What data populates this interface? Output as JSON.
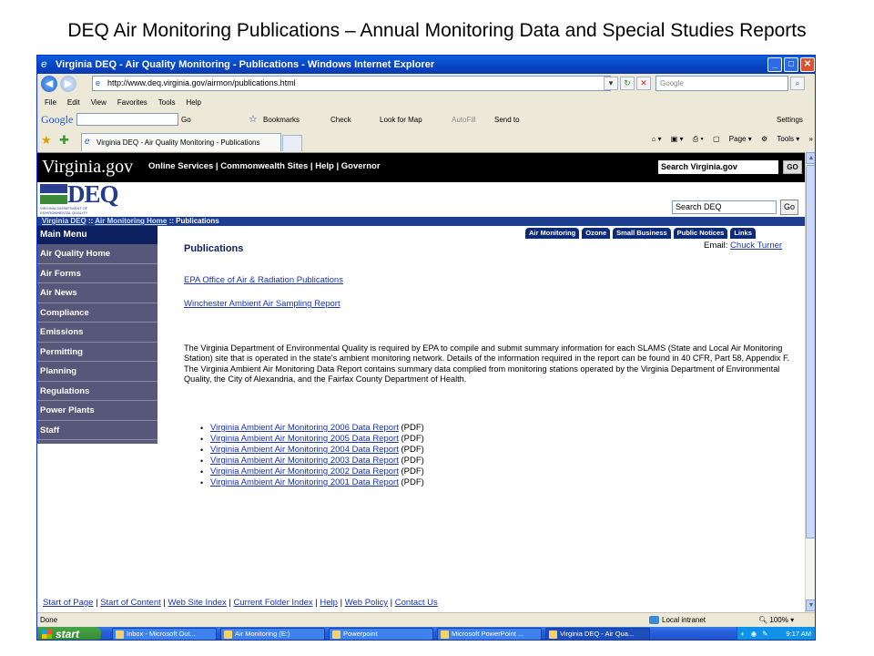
{
  "slide_title": "DEQ Air Monitoring Publications – Annual Monitoring Data and Special Studies Reports",
  "window": {
    "title": "Virginia DEQ - Air Quality Monitoring - Publications - Windows Internet Explorer",
    "url": "http://www.deq.virginia.gov/airmon/publications.html",
    "search_placeholder": "Google",
    "menu": [
      "File",
      "Edit",
      "View",
      "Favorites",
      "Tools",
      "Help"
    ],
    "google_toolbar": {
      "logo": "Google",
      "go": "Go",
      "bookmarks": "Bookmarks",
      "check": "Check",
      "look_for_map": "Look for Map",
      "autofill": "AutoFill",
      "send_to": "Send to",
      "settings": "Settings"
    },
    "tab_label": "Virginia DEQ - Air Quality Monitoring - Publications",
    "commands": {
      "page": "Page",
      "tools": "Tools"
    },
    "status": {
      "text": "Done",
      "zone": "Local intranet",
      "zoom": "100%"
    }
  },
  "site": {
    "brand": "Virginia.gov",
    "top_links": "Online Services | Commonwealth Sites | Help | Governor",
    "search_label": "Search Virginia.gov",
    "go": "GO",
    "deq_logo": "DEQ",
    "deq_logo_sub": "VIRGINIA DEPARTMENT OF ENVIRONMENTAL QUALITY",
    "deq_search": "Search DEQ",
    "deq_go": "Go",
    "breadcrumb": {
      "link1": "Virginia DEQ",
      "sep1": " :: ",
      "link2": "Air Monitoring Home",
      "sep2": " :: ",
      "current": "Publications"
    },
    "main_menu_title": "Main Menu",
    "menu_items": [
      "Air Quality Home",
      "Air Forms",
      "Air News",
      "Compliance",
      "Emissions",
      "Permitting",
      "Planning",
      "Regulations",
      "Power Plants",
      "Staff"
    ],
    "nav_tabs": [
      "Air Monitoring",
      "Ozone",
      "Small Business",
      "Public Notices",
      "Links"
    ],
    "email_label": "Email:",
    "email_contact": "Chuck Turner",
    "page_title": "Publications",
    "link1": "EPA Office of Air & Radiation Publications",
    "link2": "Winchester Ambient Air Sampling Report",
    "paragraph": "The Virginia Department of Environmental Quality is required by EPA to compile and submit summary information for each SLAMS (State and Local Air Monitoring Station) site that is operated in the state's ambient monitoring network. Details of the information required in the report can be found in 40 CFR, Part 58, Appendix F. The Virginia Ambient Air Monitoring Data Report contains summary data complied from monitoring stations operated by the Virginia Department of Environmental Quality, the City of Alexandria, and the Fairfax County Department of Health.",
    "reports": [
      "Virginia Ambient Air Monitoring 2006 Data Report",
      "Virginia Ambient Air Monitoring 2005 Data Report",
      "Virginia Ambient Air Monitoring 2004 Data Report",
      "Virginia Ambient Air Monitoring 2003 Data Report",
      "Virginia Ambient Air Monitoring 2002 Data Report",
      "Virginia Ambient Air Monitoring 2001 Data Report"
    ],
    "pdf_suffix": " (PDF)",
    "footer_links": [
      "Start of Page",
      "Start of Content",
      "Web Site Index",
      "Current Folder Index",
      "Help",
      "Web Policy",
      "Contact Us"
    ],
    "footer_sep": " | "
  },
  "taskbar": {
    "start": "start",
    "tasks": [
      "Inbox - Microsoft Out...",
      "Air Monitoring (E:)",
      "Powerpoint",
      "Microsoft PowerPoint ...",
      "Virginia DEQ - Air Qua..."
    ],
    "clock": "9:17 AM"
  }
}
